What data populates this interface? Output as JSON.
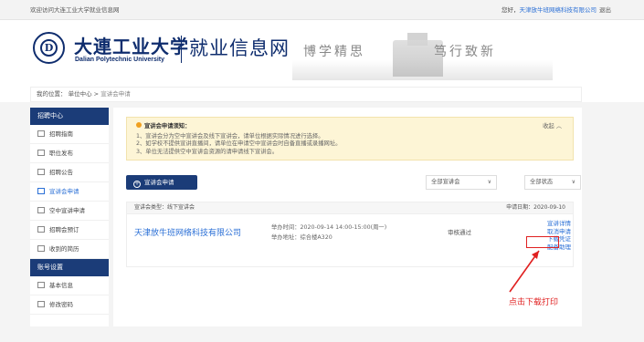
{
  "topbar": {
    "welcome": "欢迎访问大连工业大学就业信息网",
    "greeting": "您好，",
    "company": "天津放牛班网络科技有限公司",
    "logout": "退出"
  },
  "header": {
    "seal_glyph": "D",
    "school_cn": "大連工业大学",
    "school_en": "Dalian Polytechnic University",
    "site_title": "就业信息网",
    "motto_left": "博学精思",
    "motto_right": "笃行致新"
  },
  "breadcrumb": {
    "prefix": "我的位置：",
    "level1": "单位中心",
    "sep": ">",
    "current": "宣讲会申请"
  },
  "sidebar": {
    "section1": "招聘中心",
    "items1": [
      {
        "label": "招聘指南",
        "icon": "document-icon",
        "active": false
      },
      {
        "label": "职位发布",
        "icon": "document-icon",
        "active": false
      },
      {
        "label": "招聘公告",
        "icon": "document-icon",
        "active": false
      },
      {
        "label": "宣讲会申请",
        "icon": "document-icon",
        "active": true
      },
      {
        "label": "空中宣讲申请",
        "icon": "document-icon",
        "active": false
      },
      {
        "label": "招聘会预订",
        "icon": "document-icon",
        "active": false
      },
      {
        "label": "收到的简历",
        "icon": "document-icon",
        "active": false
      }
    ],
    "section2": "账号设置",
    "items2": [
      {
        "label": "基本信息",
        "icon": "document-icon",
        "active": false
      },
      {
        "label": "修改密码",
        "icon": "document-icon",
        "active": false
      }
    ]
  },
  "notice": {
    "title": "宣讲会申请须知：",
    "lines": [
      "1、宣讲会分为空中宣讲会及线下宣讲会，请单位根据实际情况进行选择。",
      "2、如学校不提供宣讲直播间，请单位在申请空中宣讲会时自备直播或录播网址。",
      "3、单位无法提供空中宣讲会资源的请申请线下宣讲会。"
    ],
    "collapse": "收起 ︿"
  },
  "toolbar": {
    "apply_label": "宣讲会申请",
    "filter_type": "全部宣讲会",
    "filter_status": "全部状态"
  },
  "record": {
    "type_label": "宣讲会类型：线下宣讲会",
    "apply_date": "申请日期：2020-09-10",
    "company": "天津放牛班网络科技有限公司",
    "time": "举办时间：2020-09-14 14:00-15:00(周一)",
    "place": "举办地址：综合楼A320",
    "status": "审核通过",
    "actions": [
      "宣讲详情",
      "取消申请",
      "下载凭证",
      "配备助理"
    ]
  },
  "annotation": {
    "text": "点击下载打印",
    "color": "#e02020"
  },
  "colors": {
    "brand": "#1b3c78",
    "link": "#2a6fd6",
    "notice_bg": "#fdf5d6"
  }
}
